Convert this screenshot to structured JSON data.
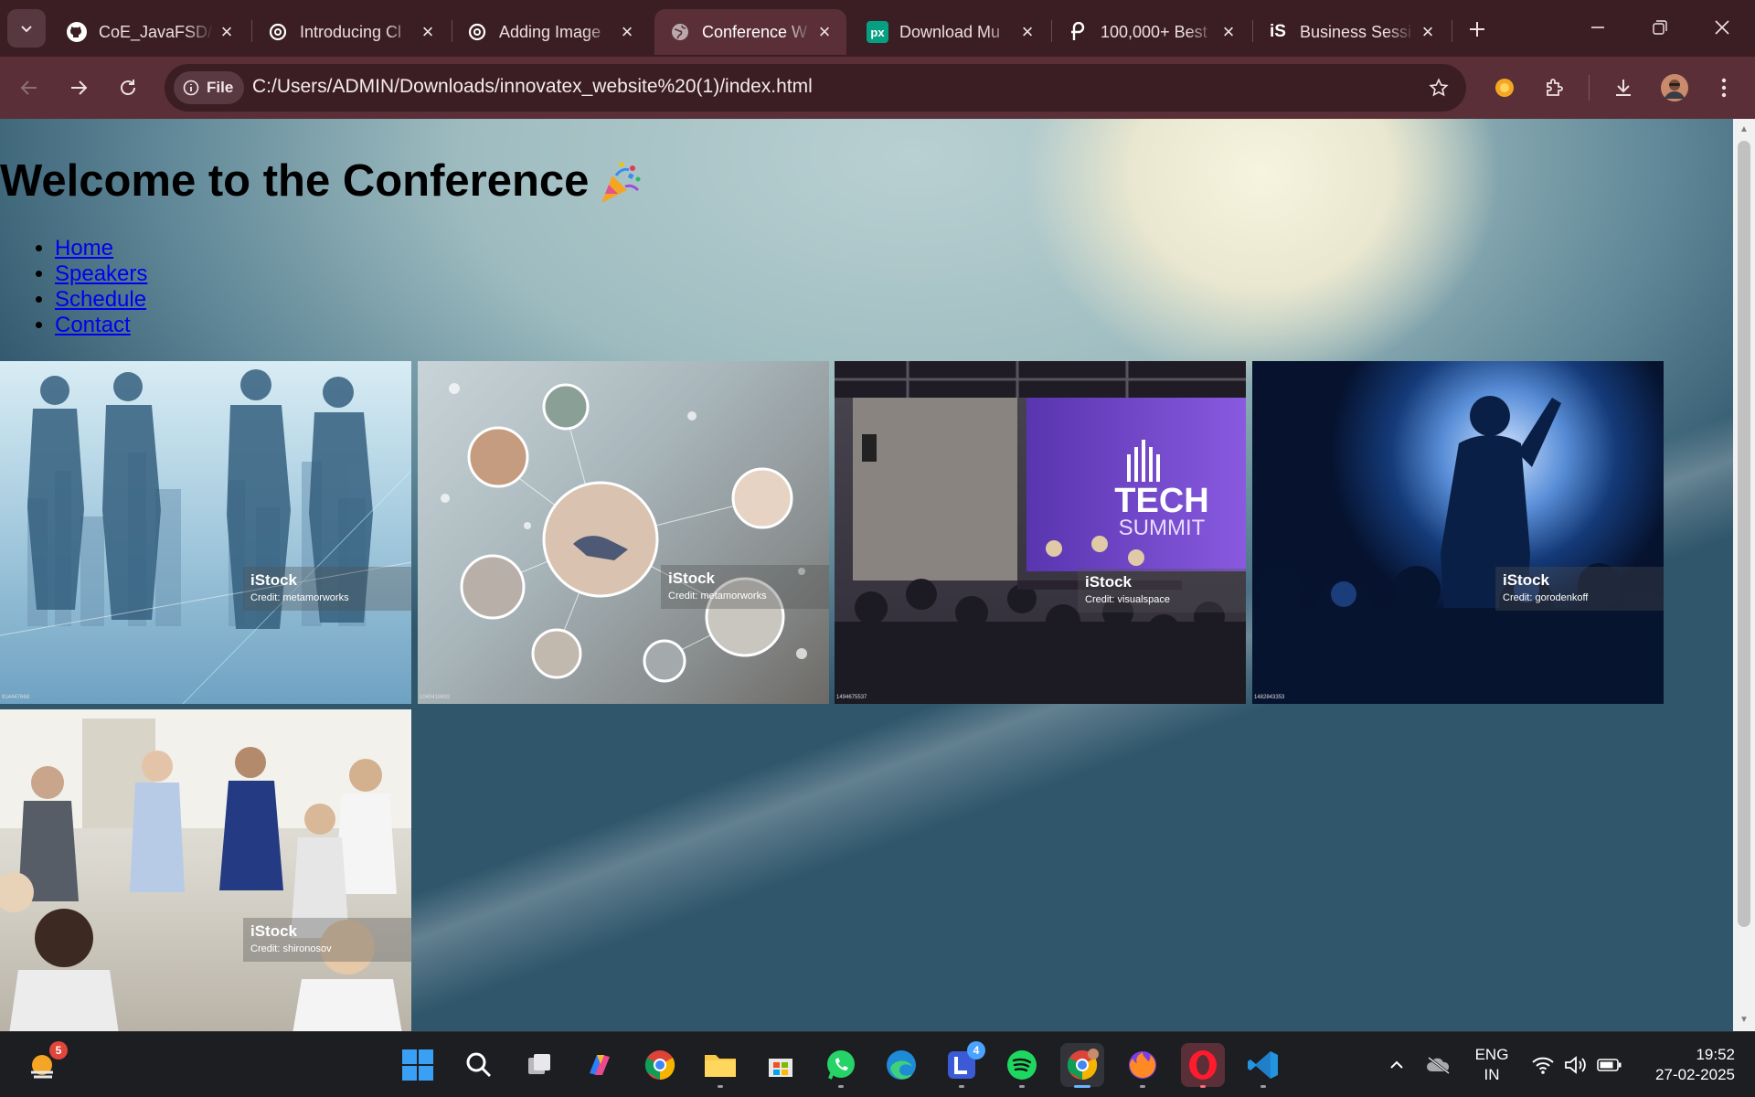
{
  "browser": {
    "tabs": [
      {
        "title": "CoE_JavaFSD/",
        "icon": "github-icon",
        "active": false
      },
      {
        "title": "Introducing Cl",
        "icon": "openai-icon",
        "active": false
      },
      {
        "title": "Adding Image",
        "icon": "openai-icon",
        "active": false
      },
      {
        "title": "Conference W",
        "icon": "globe-icon",
        "active": true
      },
      {
        "title": "Download Mu",
        "icon": "pexels-icon",
        "active": false
      },
      {
        "title": "100,000+ Best",
        "icon": "pixabay-icon",
        "active": false
      },
      {
        "title": "Business Sessi",
        "icon": "istock-icon",
        "active": false
      }
    ],
    "address": {
      "chip_label": "File",
      "url": "C:/Users/ADMIN/Downloads/innovatex_website%20(1)/index.html"
    },
    "colors": {
      "frame": "#3a1e24",
      "toolbar": "#5a2f38"
    }
  },
  "page": {
    "heading": "Welcome to the Conference",
    "heading_emoji": "party-popper-icon",
    "nav": [
      "Home",
      "Speakers",
      "Schedule",
      "Contact"
    ],
    "photos": [
      {
        "brand": "iStock",
        "credit": "Credit: metamorworks",
        "code": "914447668"
      },
      {
        "brand": "iStock",
        "credit": "Credit: metamorworks",
        "code": "1040418692"
      },
      {
        "brand": "iStock",
        "credit": "Credit: visualspace",
        "code": "1494675537"
      },
      {
        "brand": "iStock",
        "credit": "Credit: gorodenkoff",
        "code": "1482843353"
      },
      {
        "brand": "iStock",
        "credit": "Credit: shironosov",
        "code": ""
      }
    ],
    "stage_banner": {
      "line1": "TECH",
      "line2": "SUMMIT"
    }
  },
  "taskbar": {
    "weather_badge": "5",
    "teams_badge": "4",
    "language": {
      "line1": "ENG",
      "line2": "IN"
    },
    "clock": {
      "time": "19:52",
      "date": "27-02-2025"
    }
  }
}
